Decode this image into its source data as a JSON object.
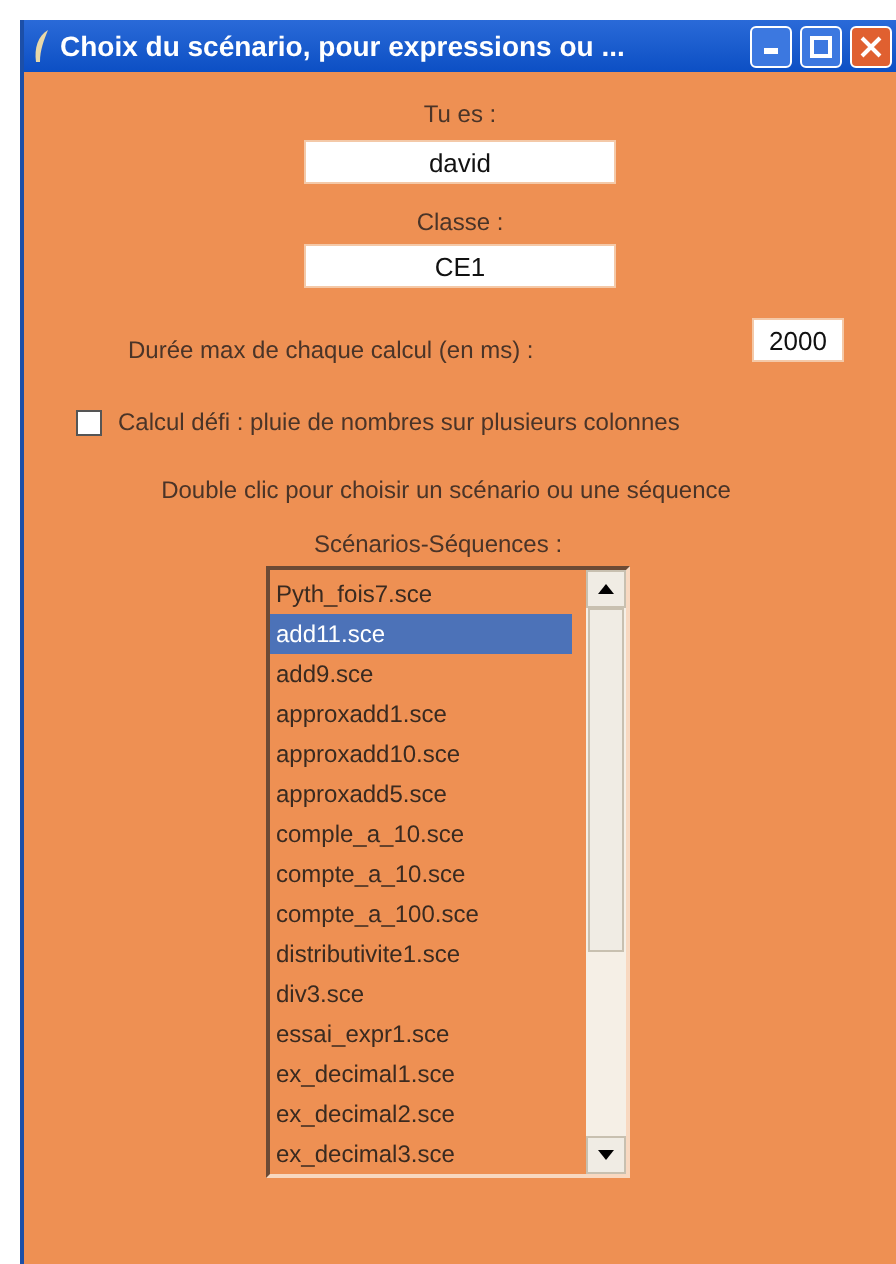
{
  "window": {
    "title": "Choix du scénario, pour expressions ou ..."
  },
  "name_label": "Tu es :",
  "name_value": "david",
  "class_label": "Classe :",
  "class_value": "CE1",
  "duration_label": "Durée max de chaque calcul  (en ms) :",
  "duration_value": "2000",
  "challenge": {
    "label": "Calcul défi : pluie de nombres sur plusieurs colonnes",
    "checked": false
  },
  "hint": "Double clic pour choisir un scénario ou une séquence",
  "list_label": "Scénarios-Séquences :",
  "scenarios": [
    {
      "label": "Pyth_fois7.sce",
      "selected": false
    },
    {
      "label": "add11.sce",
      "selected": true
    },
    {
      "label": "add9.sce",
      "selected": false
    },
    {
      "label": "approxadd1.sce",
      "selected": false
    },
    {
      "label": "approxadd10.sce",
      "selected": false
    },
    {
      "label": "approxadd5.sce",
      "selected": false
    },
    {
      "label": "comple_a_10.sce",
      "selected": false
    },
    {
      "label": "compte_a_10.sce",
      "selected": false
    },
    {
      "label": "compte_a_100.sce",
      "selected": false
    },
    {
      "label": "distributivite1.sce",
      "selected": false
    },
    {
      "label": "div3.sce",
      "selected": false
    },
    {
      "label": "essai_expr1.sce",
      "selected": false
    },
    {
      "label": "ex_decimal1.sce",
      "selected": false
    },
    {
      "label": "ex_decimal2.sce",
      "selected": false
    },
    {
      "label": "ex_decimal3.sce",
      "selected": false
    }
  ]
}
